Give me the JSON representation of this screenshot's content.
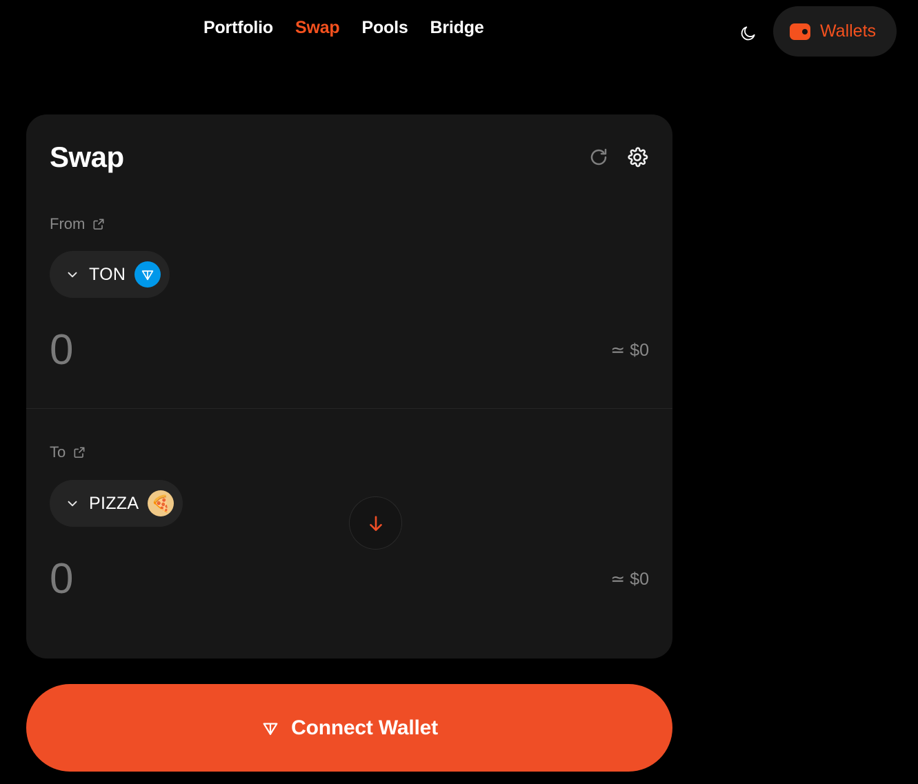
{
  "header": {
    "nav": [
      {
        "label": "Portfolio",
        "active": false
      },
      {
        "label": "Swap",
        "active": true
      },
      {
        "label": "Pools",
        "active": false
      },
      {
        "label": "Bridge",
        "active": false
      }
    ],
    "theme_toggle_icon": "moon-icon",
    "wallets_button": {
      "label": "Wallets",
      "icon": "wallet-icon"
    }
  },
  "swap_card": {
    "title": "Swap",
    "refresh_icon": "refresh-icon",
    "settings_icon": "gear-icon",
    "from": {
      "label": "From",
      "external_link_icon": "external-link-icon",
      "token": "TON",
      "token_logo": "ton-logo",
      "chevron_icon": "chevron-down-icon",
      "amount": "",
      "amount_placeholder": "0",
      "usd_value": "≃ $0"
    },
    "switch_icon": "arrow-down-icon",
    "to": {
      "label": "To",
      "external_link_icon": "external-link-icon",
      "token": "PIZZA",
      "token_logo": "pizza-logo",
      "token_emoji": "🍕",
      "chevron_icon": "chevron-down-icon",
      "amount": "",
      "amount_placeholder": "0",
      "usd_value": "≃ $0"
    }
  },
  "connect_wallet": {
    "label": "Connect Wallet",
    "icon": "ton-diamond-icon"
  },
  "colors": {
    "accent": "#ef4e26",
    "accent_text": "#f4511e",
    "page_bg": "#000000",
    "card_bg": "#171717",
    "pill_bg": "#242424",
    "ton_blue": "#0098ea",
    "pizza_bg": "#f0c987",
    "muted_text": "#8a8a8a"
  }
}
